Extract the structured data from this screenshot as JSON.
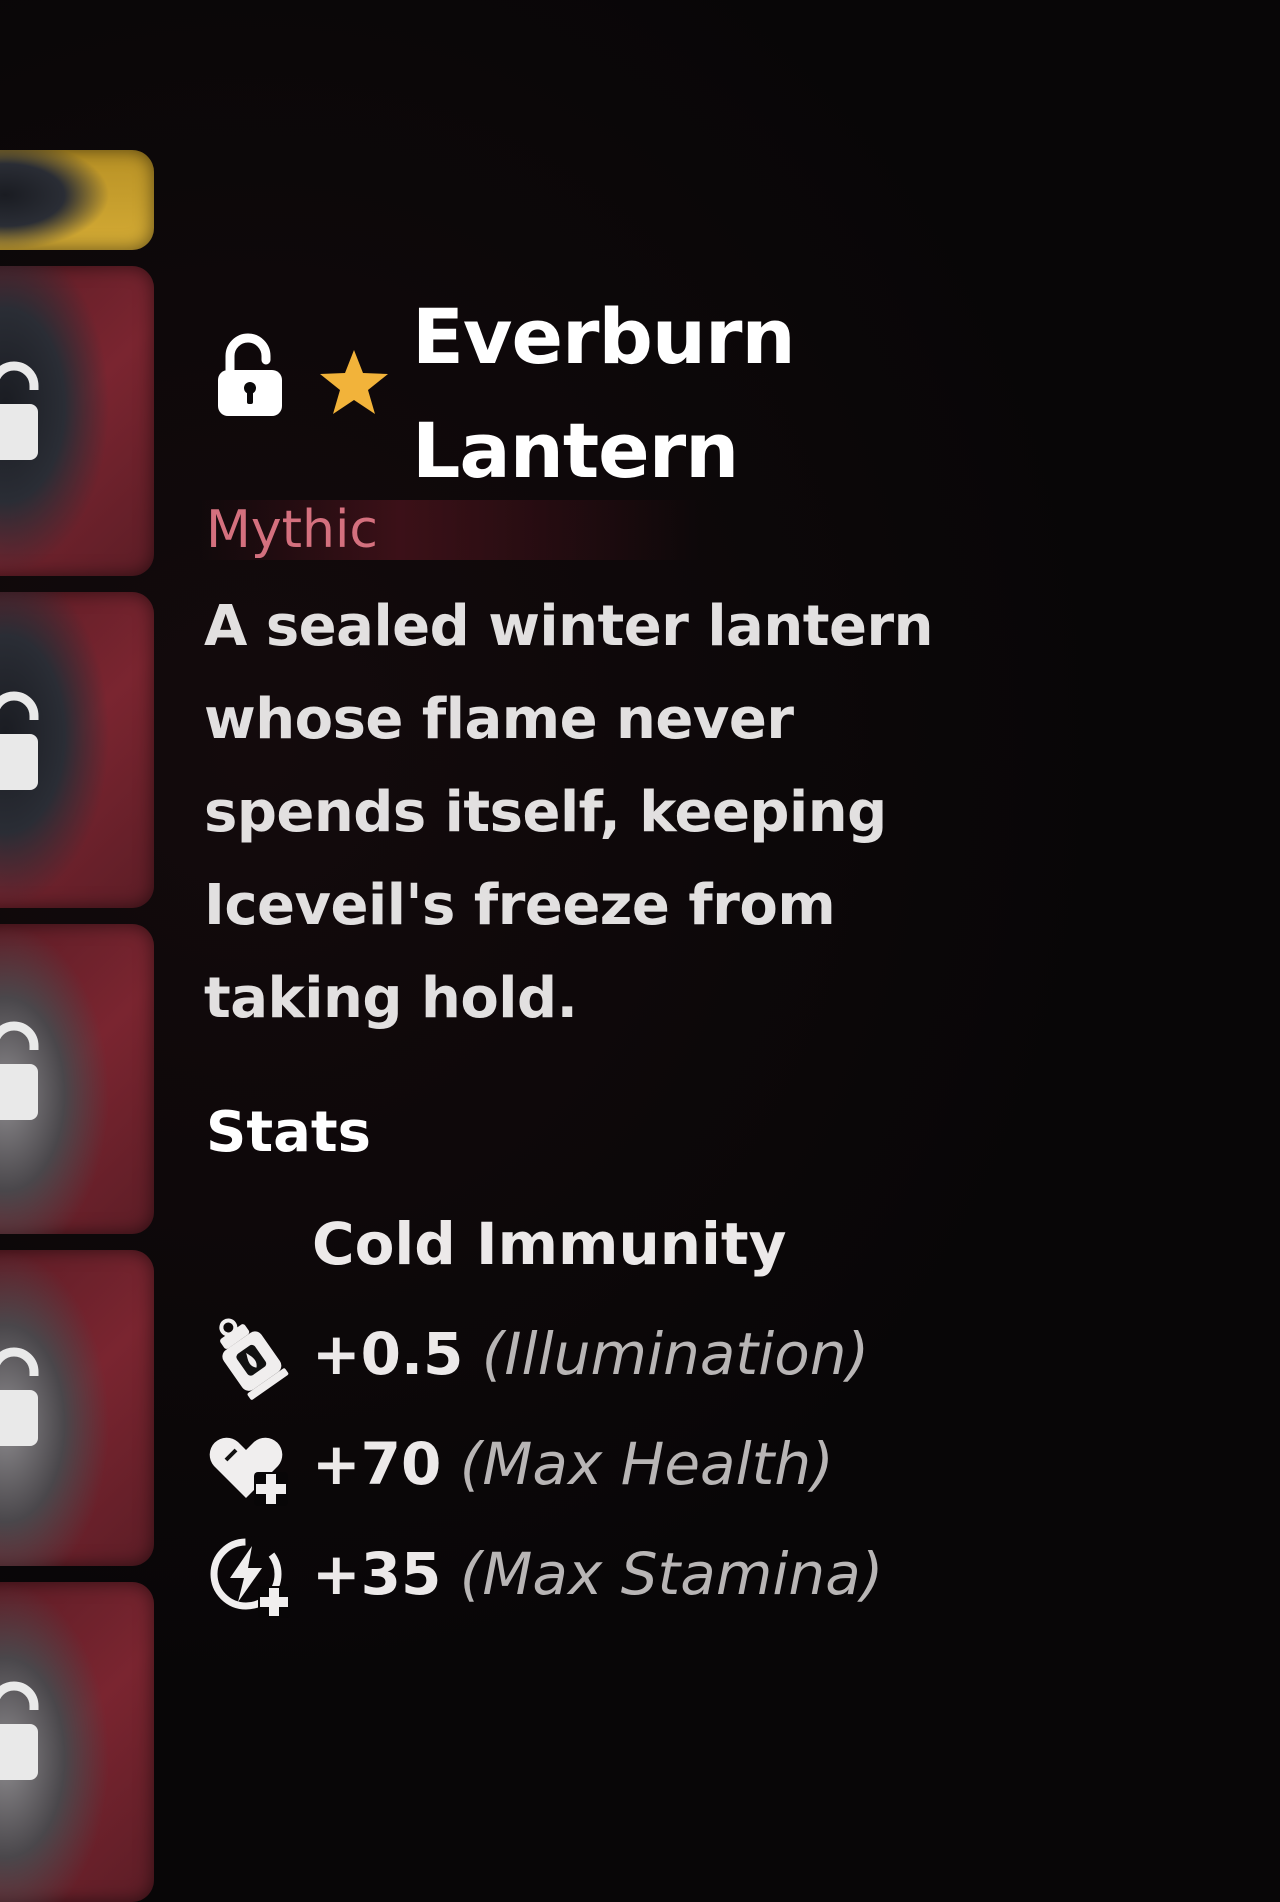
{
  "item": {
    "name_line1": "Everburn",
    "name_line2": "Lantern",
    "rarity": "Mythic",
    "locked_icon": "padlock-open-icon",
    "favorite_icon": "star-icon",
    "description_lines": [
      "A sealed winter lantern",
      "whose flame never",
      "spends itself, keeping",
      "Iceveil's freeze from",
      "taking hold."
    ]
  },
  "stats": {
    "heading": "Stats",
    "rows": [
      {
        "icon": "",
        "value": "Cold Immunity",
        "label": ""
      },
      {
        "icon": "lantern-icon",
        "value": "+0.5",
        "label": "(Illumination)"
      },
      {
        "icon": "heart-plus-icon",
        "value": "+70",
        "label": "(Max Health)"
      },
      {
        "icon": "stamina-plus-icon",
        "value": "+35",
        "label": "(Max Stamina)"
      }
    ]
  },
  "colors": {
    "background": "#080607",
    "rarity_mythic": "#d4707e",
    "star": "#f2b33a",
    "slot_red": "#7a2530",
    "slot_gold": "#d4ab35"
  }
}
